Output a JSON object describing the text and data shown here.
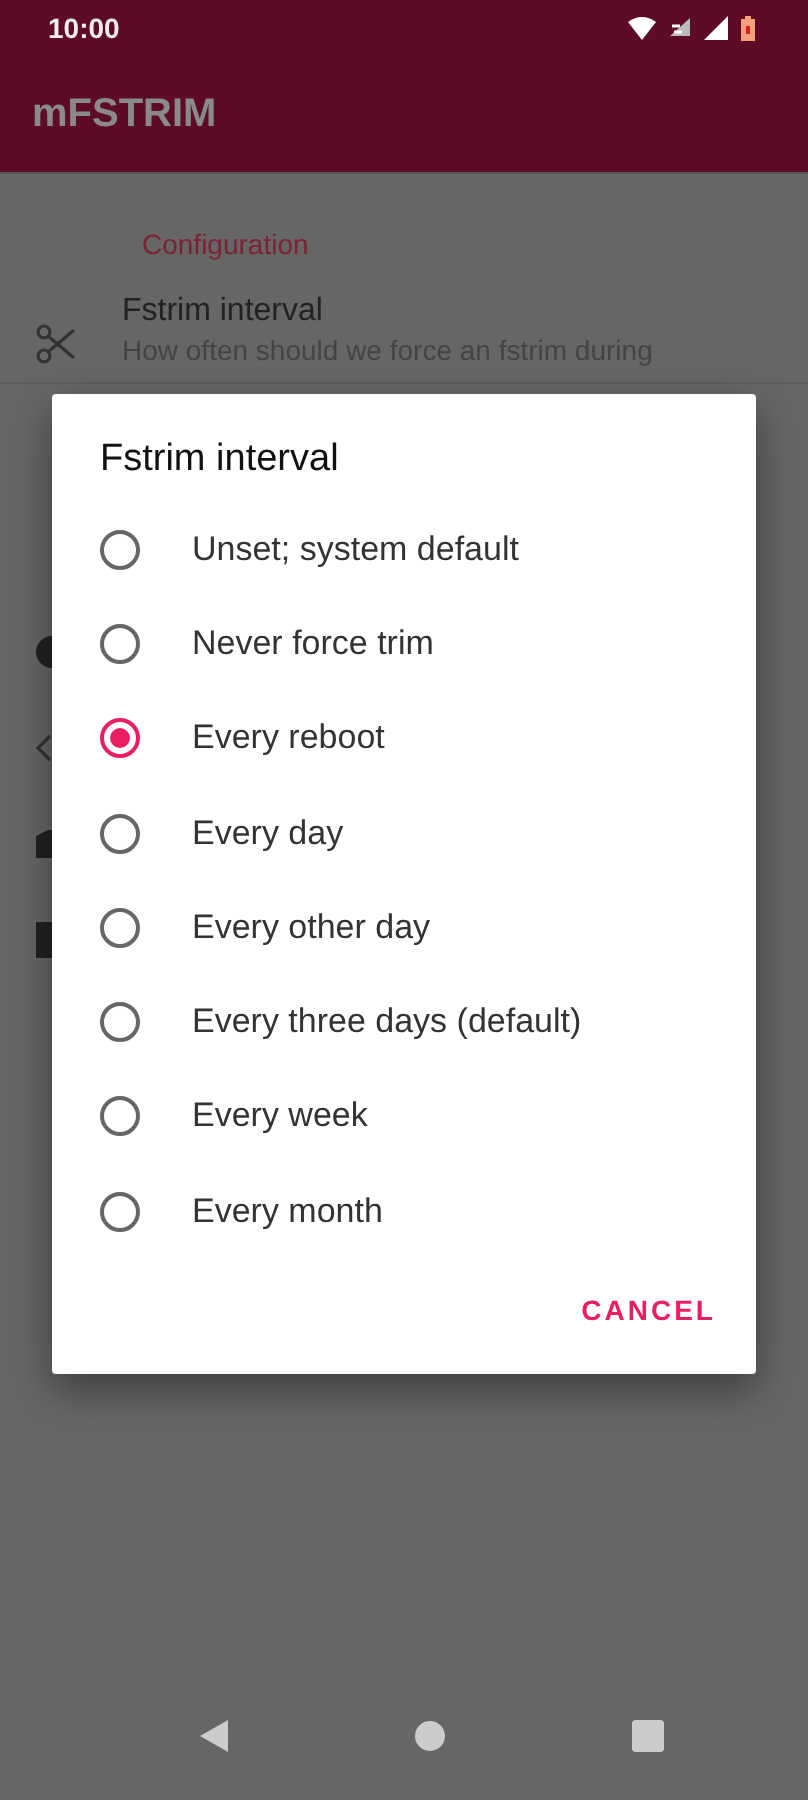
{
  "status_bar": {
    "time": "10:00"
  },
  "app_bar": {
    "title": "mFSTRIM"
  },
  "settings": {
    "category": "Configuration",
    "item": {
      "title": "Fstrim interval",
      "summary": "How often should we force an fstrim during"
    }
  },
  "dialog": {
    "title": "Fstrim interval",
    "options": [
      {
        "label": "Unset; system default",
        "selected": false
      },
      {
        "label": "Never force trim",
        "selected": false
      },
      {
        "label": "Every reboot",
        "selected": true
      },
      {
        "label": "Every day",
        "selected": false
      },
      {
        "label": "Every other day",
        "selected": false
      },
      {
        "label": "Every three days (default)",
        "selected": false
      },
      {
        "label": "Every week",
        "selected": false
      },
      {
        "label": "Every month",
        "selected": false
      }
    ],
    "button": "CANCEL"
  }
}
